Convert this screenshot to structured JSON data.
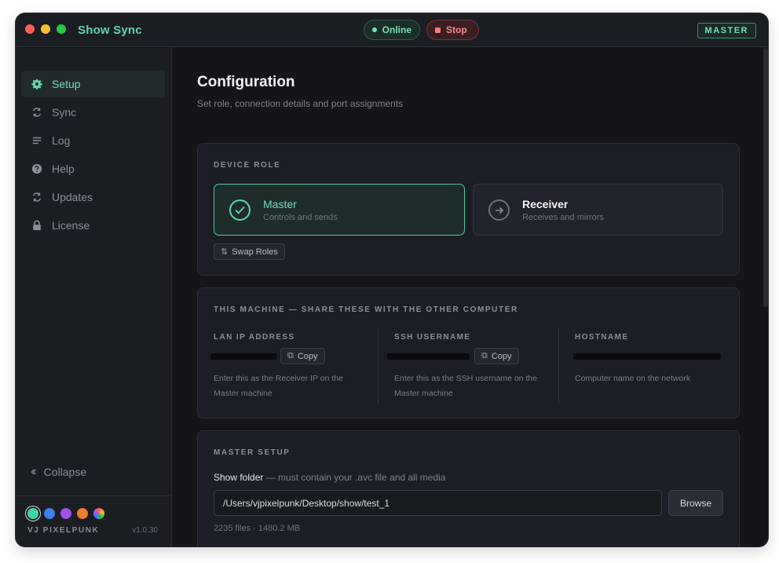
{
  "window": {
    "title": "Show Sync",
    "status_online": "Online",
    "stop_label": "Stop",
    "role_badge": "MASTER"
  },
  "sidebar": {
    "items": [
      {
        "label": "Setup",
        "icon": "gear-icon",
        "active": true
      },
      {
        "label": "Sync",
        "icon": "sync-icon",
        "active": false
      },
      {
        "label": "Log",
        "icon": "log-lines-icon",
        "active": false
      },
      {
        "label": "Help",
        "icon": "help-circle-icon",
        "active": false
      },
      {
        "label": "Updates",
        "icon": "refresh-icon",
        "active": false
      },
      {
        "label": "License",
        "icon": "lock-icon",
        "active": false
      }
    ],
    "collapse_label": "Collapse",
    "theme_swatches": [
      "#3fd3a4",
      "#3f7ef0",
      "#a052e6",
      "#f07a2e",
      "rainbow"
    ],
    "brand": "VJ PIXELPUNK",
    "version": "v1.0.30"
  },
  "main": {
    "title": "Configuration",
    "subtitle": "Set role, connection details and port assignments",
    "device_role": {
      "label": "DEVICE ROLE",
      "master": {
        "name": "Master",
        "desc": "Controls and sends"
      },
      "receiver": {
        "name": "Receiver",
        "desc": "Receives and mirrors"
      },
      "swap_label": "Swap Roles"
    },
    "machine": {
      "label": "THIS MACHINE — SHARE THESE WITH THE OTHER COMPUTER",
      "lan": {
        "label": "LAN IP ADDRESS",
        "copy": "Copy",
        "help": "Enter this as the Receiver IP on the Master machine"
      },
      "ssh": {
        "label": "SSH USERNAME",
        "copy": "Copy",
        "help": "Enter this as the SSH username on the Master machine"
      },
      "host": {
        "label": "HOSTNAME",
        "help": "Computer name on the network"
      }
    },
    "master_setup": {
      "label": "MASTER SETUP",
      "show_folder_label": "Show folder",
      "show_folder_hint": " — must contain your .avc file and all media",
      "path": "/Users/vjpixelpunk/Desktop/show/test_1",
      "browse": "Browse",
      "stats": "2235 files · 1480.2 MB"
    }
  },
  "colors": {
    "accent": "#5ed7b0",
    "danger": "#ff7a7a",
    "background": "#131519"
  }
}
